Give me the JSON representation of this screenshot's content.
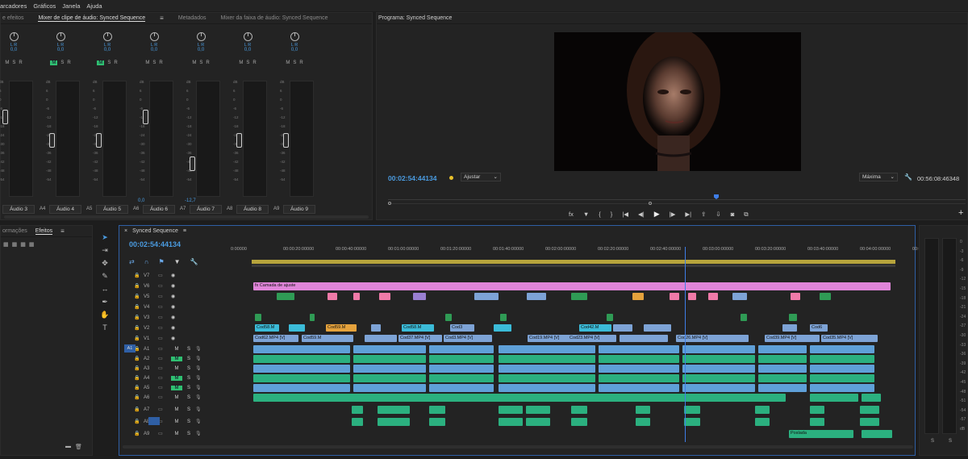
{
  "menubar": {
    "items": [
      "arcadores",
      "Gráficos",
      "Janela",
      "Ajuda"
    ]
  },
  "mixer": {
    "tabs": [
      "e efeitos",
      "Mixer de clipe de áudio: Synced Sequence",
      "Metadados",
      "Mixer da faixa de áudio: Synced Sequence"
    ],
    "pan_label": "L  R",
    "pan_value": "0,0",
    "msr": [
      "M",
      "S",
      "R"
    ],
    "db_ticks": [
      "dB",
      "6",
      "0",
      "-6",
      "-12",
      "-18",
      "-24",
      "-30",
      "-36",
      "-42",
      "-48",
      "-54"
    ],
    "channels": [
      {
        "id": "",
        "name": "Áudio 3",
        "value": "",
        "m_on": false,
        "fader": 0.28
      },
      {
        "id": "A4",
        "name": "Áudio 4",
        "value": "",
        "m_on": true,
        "fader": 0.5
      },
      {
        "id": "A5",
        "name": "Áudio 5",
        "value": "",
        "m_on": true,
        "fader": 0.5
      },
      {
        "id": "A6",
        "name": "Áudio 6",
        "value": "0,0",
        "m_on": false,
        "fader": 0.28
      },
      {
        "id": "A7",
        "name": "Áudio 7",
        "value": "-12,7",
        "m_on": false,
        "fader": 0.72
      },
      {
        "id": "A8",
        "name": "Áudio 8",
        "value": "",
        "m_on": false,
        "fader": 0.5
      },
      {
        "id": "A9",
        "name": "Áudio 9",
        "value": "",
        "m_on": false,
        "fader": 0.5
      }
    ]
  },
  "program": {
    "title": "Programa: Synced Sequence",
    "timecode": "00:02:54:44134",
    "fit": "Ajustar",
    "quality": "Máxima",
    "duration": "00:56:08:46348",
    "transport_icons": [
      "fx",
      "marker",
      "{",
      "}",
      "|<-",
      "<|",
      "▶",
      "|>",
      "->|",
      "lift",
      "extract",
      "camera",
      "export"
    ],
    "add": "+"
  },
  "project": {
    "tabs": [
      "ormações",
      "Efeitos"
    ],
    "menu": "≡"
  },
  "timeline": {
    "title": "Synced Sequence",
    "timecode": "00:02:54:44134",
    "ruler": [
      "0:00000",
      "00:00:20:00000",
      "00:00:40:00000",
      "00:01:00:00000",
      "00:01:20:00000",
      "00:01:40:00000",
      "00:02:00:00000",
      "00:02:20:00000",
      "00:02:40:00000",
      "00:03:00:00000",
      "00:03:20:00000",
      "00:03:40:00000",
      "00:04:00:00000",
      "00:04:"
    ],
    "video_tracks": [
      "V7",
      "V6",
      "V5",
      "V4",
      "V3",
      "V2",
      "V1"
    ],
    "audio_tracks": [
      "A1",
      "A2",
      "A3",
      "A4",
      "A5",
      "A6",
      "A7",
      "A8",
      "A9"
    ],
    "adjustment_label": "Camada de ajuste",
    "clip_labels": [
      "Cod58.M",
      "Cod59.M",
      "Cod58.M",
      "Cod3",
      "Cod42.M",
      "Cod6",
      "Cod62.MP4 [V]",
      "Cod59.M",
      "Cod37.MP4 [V]",
      "Cod3.MP4 [V]",
      "Cod19.MP4 [V]",
      "Cod23.MP4 [V]",
      "Cod26.MP4 [V]",
      "Cod39.MP4 [V]",
      "Cod7",
      "Cod22.MP4 [V]",
      "Cod9.MP4 [V]",
      "Cod23.MP4 [V]",
      "Cod24.MP4 [V]",
      "Cod26.MP4 [V]",
      "Cod35.MP4 [V]"
    ],
    "music_label": "Poslada"
  },
  "tools": [
    "selection",
    "track-select",
    "ripple",
    "razor",
    "slip",
    "pen",
    "hand",
    "text"
  ],
  "colors": {
    "accent": "#4a9be0",
    "mute_on": "#2fbf71",
    "adjustment": "#e085d9",
    "playhead": "#3f7ee8"
  }
}
